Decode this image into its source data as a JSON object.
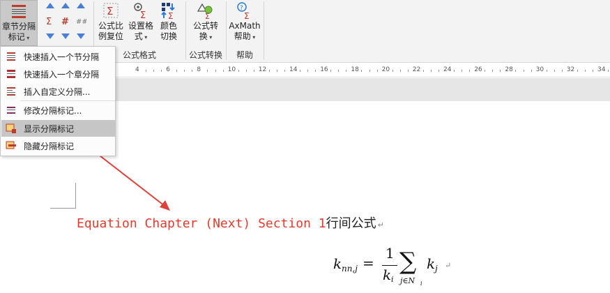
{
  "ribbon": {
    "section_break_label_line1": "章节分隔",
    "section_break_label_line2": "标记",
    "reset_label_line1": "公式比",
    "reset_label_line2": "例复位",
    "settings_label_line1": "设置格",
    "settings_label_line2": "式",
    "color_label_line1": "颜色",
    "color_label_line2": "切换",
    "convert_label_line1": "公式转",
    "convert_label_line2": "换",
    "help_label_line1": "AxMath",
    "help_label_line2": "帮助",
    "groups": {
      "format": "公式格式",
      "convert": "公式转换",
      "help": "帮助"
    }
  },
  "menu": {
    "items": [
      {
        "label": "快速插入一个节分隔",
        "icon": "section-break-icon"
      },
      {
        "label": "快速插入一个章分隔",
        "icon": "chapter-break-icon"
      },
      {
        "label": "插入自定义分隔...",
        "icon": "custom-break-icon"
      },
      {
        "label": "修改分隔标记...",
        "icon": "edit-mark-icon"
      },
      {
        "label": "显示分隔标记",
        "icon": "show-mark-icon"
      },
      {
        "label": "隐藏分隔标记",
        "icon": "hide-mark-icon"
      }
    ],
    "selected_index": 4
  },
  "ruler": {
    "ticks": [
      "4",
      "6",
      "8",
      "10",
      "12",
      "14",
      "16",
      "18",
      "20",
      "22",
      "24",
      "26",
      "28",
      "30",
      "32",
      "34"
    ]
  },
  "document": {
    "chapter_field": "Equation Chapter (Next) Section 1",
    "line_text": "行间公式",
    "paragraph_mark": "↵"
  },
  "formula": {
    "lhs_k": "k",
    "lhs_sub": "nn,j",
    "equals": "=",
    "numerator": "1",
    "den_k": "k",
    "den_sub": "i",
    "sum": "∑",
    "sum_sub": "j∈N",
    "sum_sub_sub": "i",
    "rhs_k": "k",
    "rhs_sub": "j"
  },
  "colors": {
    "accent_red": "#e8392d",
    "arrow_red": "#e0403a",
    "icon_blue": "#4a7fd6",
    "menu_selected": "#c6c6c6"
  }
}
